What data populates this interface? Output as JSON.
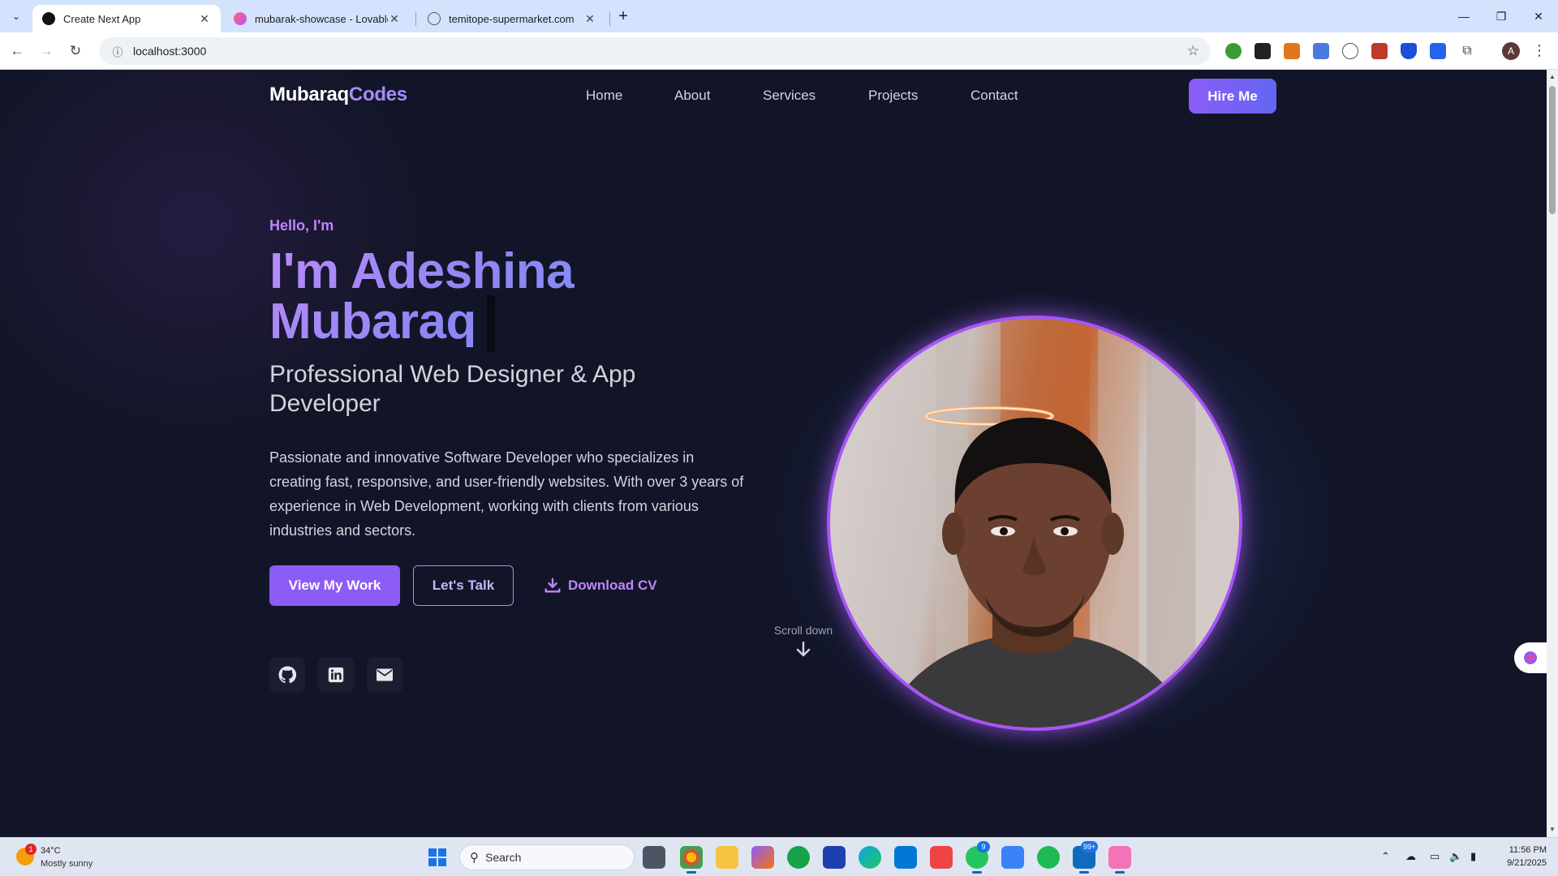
{
  "browser": {
    "tabs": [
      {
        "title": "Create Next App",
        "active": true
      },
      {
        "title": "mubarak-showcase - Lovable",
        "active": false
      },
      {
        "title": "temitope-supermarket.com",
        "active": false
      }
    ],
    "url": "localhost:3000",
    "profile_initial": "A"
  },
  "site": {
    "logo_main": "Mubaraq",
    "logo_accent": "Codes",
    "nav": [
      "Home",
      "About",
      "Services",
      "Projects",
      "Contact"
    ],
    "hire_button": "Hire Me"
  },
  "hero": {
    "greeting": "Hello, I'm",
    "name_line1": "I'm Adeshina",
    "name_line2": "Mubaraq",
    "role": "Professional Web Designer & App Developer",
    "bio": "Passionate and innovative Software Developer who specializes in creating fast, responsive, and user-friendly websites. With over 3 years of experience in Web Development, working with clients from various industries and sectors.",
    "btn_work": "View My Work",
    "btn_talk": "Let's Talk",
    "btn_cv": "Download CV",
    "scroll_hint": "Scroll down",
    "socials": [
      "github-icon",
      "linkedin-icon",
      "mail-icon"
    ]
  },
  "taskbar": {
    "weather_temp": "34°C",
    "weather_desc": "Mostly sunny",
    "weather_badge": "1",
    "search_label": "Search",
    "whatsapp_badge": "9",
    "outlook_badge": "99+",
    "time": "11:56 PM",
    "date": "9/21/2025"
  },
  "colors": {
    "accent": "#8b5cf6",
    "accent_light": "#a78bfa",
    "page_bg": "#121527"
  }
}
